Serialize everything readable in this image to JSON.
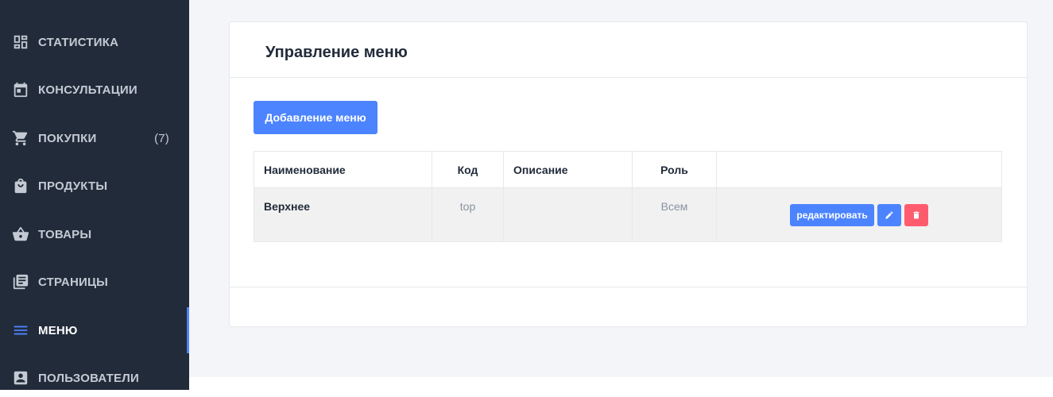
{
  "sidebar": {
    "items": [
      {
        "label": "СТАТИСТИКА",
        "icon": "dashboard-icon",
        "badge": ""
      },
      {
        "label": "КОНСУЛЬТАЦИИ",
        "icon": "calendar-icon",
        "badge": ""
      },
      {
        "label": "ПОКУПКИ",
        "icon": "cart-icon",
        "badge": "(7)"
      },
      {
        "label": "ПРОДУКТЫ",
        "icon": "shopping-bag-icon",
        "badge": ""
      },
      {
        "label": "ТОВАРЫ",
        "icon": "basket-icon",
        "badge": ""
      },
      {
        "label": "СТРАНИЦЫ",
        "icon": "library-books-icon",
        "badge": ""
      },
      {
        "label": "МЕНЮ",
        "icon": "menu-icon",
        "badge": "",
        "active": true
      },
      {
        "label": "ПОЛЬЗОВАТЕЛИ",
        "icon": "account-box-icon",
        "badge": ""
      }
    ]
  },
  "page": {
    "title": "Управление меню",
    "add_button": "Добавление меню"
  },
  "table": {
    "columns": [
      "Наименование",
      "Код",
      "Описание",
      "Роль",
      ""
    ],
    "rows": [
      {
        "name": "Верхнее",
        "code": "top",
        "description": "",
        "role": "Всем",
        "edit_label": "редактировать"
      }
    ]
  },
  "colors": {
    "sidebar_bg": "#222b3a",
    "accent": "#4c84ff",
    "danger": "#ff5b6e",
    "page_bg": "#f4f5f8"
  }
}
